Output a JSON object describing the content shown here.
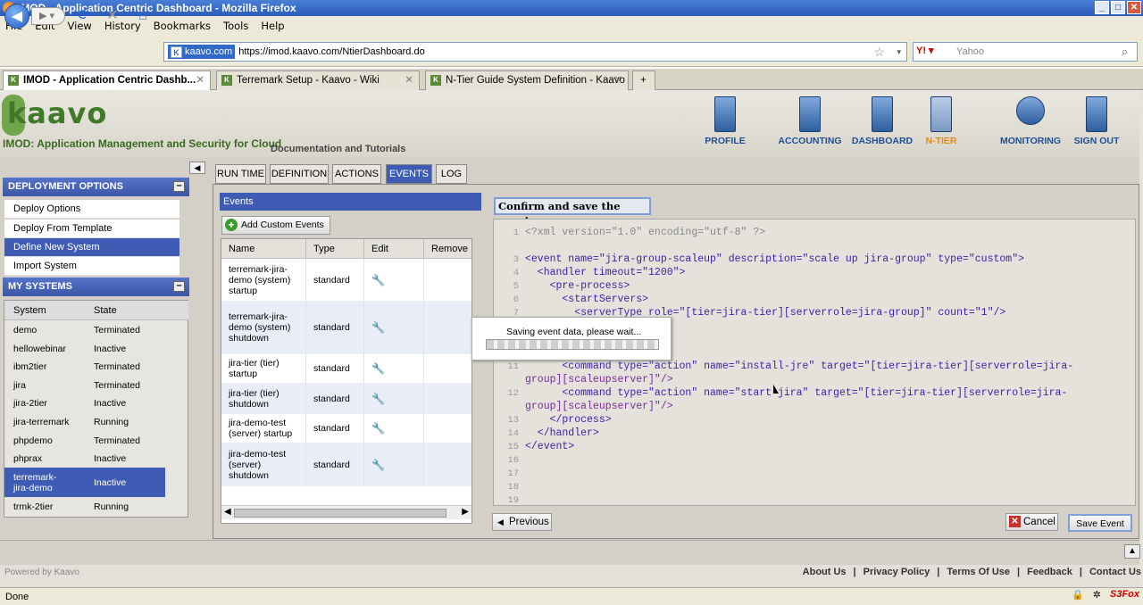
{
  "window": {
    "title": "IMOD - Application Centric Dashboard - Mozilla Firefox"
  },
  "menu": [
    "File",
    "Edit",
    "View",
    "History",
    "Bookmarks",
    "Tools",
    "Help"
  ],
  "url": {
    "site": "kaavo.com",
    "address": "https://imod.kaavo.com/NtierDashboard.do"
  },
  "search": {
    "placeholder": "Yahoo"
  },
  "browser_tabs": [
    {
      "label": "IMOD - Application Centric Dashb..."
    },
    {
      "label": "Terremark Setup - Kaavo - Wiki"
    },
    {
      "label": "N-Tier Guide System Definition - Kaavo ..."
    }
  ],
  "header": {
    "logo": "kaavo",
    "tagline": "IMOD: Application Management and Security for Cloud",
    "doc_link": "Documentation and Tutorials",
    "nav": [
      "PROFILE",
      "ACCOUNTING",
      "DASHBOARD",
      "N-TIER",
      "MONITORING",
      "SIGN OUT"
    ]
  },
  "left": {
    "deploy_title": "DEPLOYMENT OPTIONS",
    "deploy_items": [
      "Deploy Options",
      "Deploy From Template",
      "Define New System",
      "Import System"
    ],
    "systems_title": "MY SYSTEMS",
    "cols": [
      "System",
      "State"
    ],
    "systems": [
      {
        "name": "demo",
        "state": "Terminated"
      },
      {
        "name": "hellowebinar",
        "state": "Inactive"
      },
      {
        "name": "ibm2tier",
        "state": "Terminated"
      },
      {
        "name": "jira",
        "state": "Terminated"
      },
      {
        "name": "jira-2tier",
        "state": "Inactive"
      },
      {
        "name": "jira-terremark",
        "state": "Running"
      },
      {
        "name": "phpdemo",
        "state": "Terminated"
      },
      {
        "name": "phprax",
        "state": "Inactive"
      },
      {
        "name": "terremark-jira-demo",
        "state": "Inactive"
      },
      {
        "name": "trmk-2tier",
        "state": "Running"
      }
    ]
  },
  "tabs": [
    "RUN TIME",
    "DEFINITION",
    "ACTIONS",
    "EVENTS",
    "LOG"
  ],
  "events": {
    "title": "Events",
    "add_label": "Add Custom Events",
    "cols": [
      "Name",
      "Type",
      "Edit",
      "Remove"
    ],
    "rows": [
      {
        "name": "terremark-jira-demo (system) startup",
        "type": "standard"
      },
      {
        "name": "terremark-jira-demo (system) shutdown",
        "type": "standard"
      },
      {
        "name": "jira-tier (tier) startup",
        "type": "standard"
      },
      {
        "name": "jira-tier (tier) shutdown",
        "type": "standard"
      },
      {
        "name": "jira-demo-test (server) startup",
        "type": "standard"
      },
      {
        "name": "jira-demo-test (server) shutdown",
        "type": "standard"
      }
    ]
  },
  "editor": {
    "title": "Confirm and save the event",
    "line_numbers": [
      "1",
      "2",
      "3",
      "4",
      "5",
      "6",
      "7",
      "11",
      "12",
      "13",
      "14",
      "15",
      "16",
      "17",
      "18",
      "19"
    ],
    "lines": {
      "l1": "<?xml version=\"1.0\" encoding=\"utf-8\" ?>",
      "l3": "<event name=\"jira-group-scaleup\" description=\"scale up jira-group\" type=\"custom\">",
      "l4": "  <handler timeout=\"1200\">",
      "l5": "    <pre-process>",
      "l6": "      <startServers>",
      "l7": "        <serverType role=\"[tier=jira-tier][serverrole=jira-group]\" count=\"1\"/>",
      "l11a": "      <command type=\"action\" name=\"install-jre\" target=\"[tier=jira-tier][serverrole=jira-",
      "l11b": "group][scaleupserver]\"/>",
      "l12a": "      <command type=\"action\" name=\"start-jira\" target=\"[tier=jira-tier][serverrole=jira-",
      "l12b": "group][scaleupserver]\"/>",
      "l13": "    </process>",
      "l14": "  </handler>",
      "l15": "</event>"
    },
    "prev_label": "Previous",
    "cancel_label": "Cancel",
    "save_label": "Save Event"
  },
  "modal": {
    "message": "Saving event data, please wait..."
  },
  "footer": {
    "powered": "Powered by Kaavo",
    "links": [
      "About Us",
      "|",
      "Privacy Policy",
      "|",
      "Terms Of Use",
      "|",
      "Feedback",
      "|",
      "Contact Us"
    ]
  },
  "status": {
    "text": "Done",
    "badge": "S3Fox"
  }
}
